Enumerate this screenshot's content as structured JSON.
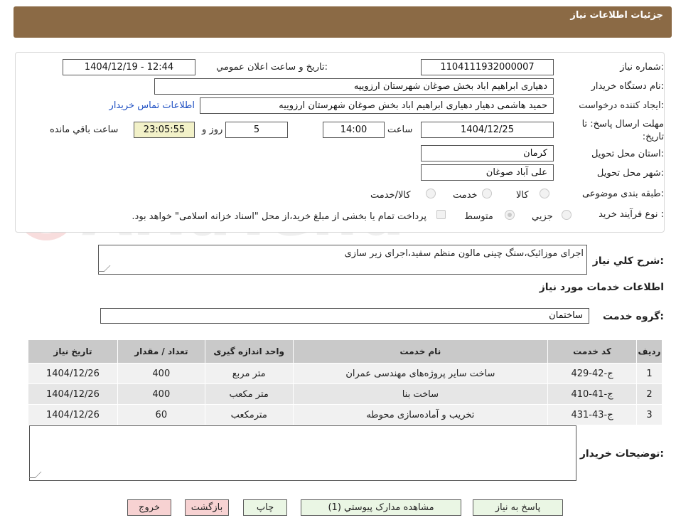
{
  "header": {
    "title": "جزئیات اطلاعات نیاز"
  },
  "form": {
    "need_number_label": "شماره نیاز:",
    "need_number": "1104111932000007",
    "announce_label": "تاریخ و ساعت اعلان عمومي:",
    "announce_value": "1404/12/19 - 12:44",
    "buyer_org_label": "نام دستگاه خريدار:",
    "buyer_org": "دهیاری ابراهیم اباد بخش صوغان شهرستان ارزوییه",
    "creator_label": "ايجاد كننده درخواست:",
    "creator": "حمید هاشمی دهیار دهیاری ابراهیم اباد بخش صوغان شهرستان ارزوییه",
    "contact_link": "اطلاعات تماس خريدار",
    "deadline_label": "مهلت ارسال پاسخ: تا تاریخ:",
    "deadline_date": "1404/12/25",
    "time_label": "ساعت",
    "deadline_time": "14:00",
    "days": "5",
    "days_label": "روز و",
    "remaining_time": "23:05:55",
    "remaining_label": "ساعت باقي مانده",
    "province_label": "استان محل تحويل:",
    "province": "كرمان",
    "city_label": "شهر محل تحويل:",
    "city": "علی آباد صوغان",
    "category_label": "طبقه بندی موضوعی:",
    "category_options": [
      "کالا",
      "خدمت",
      "کالا/خدمت"
    ],
    "process_label": "نوع فرآيند خريد :",
    "process_options": [
      "جزيي",
      "متوسط"
    ],
    "payment_note": "پرداخت تمام يا بخشی از مبلغ خريد،از محل \"اسناد خزانه اسلامی\" خواهد بود."
  },
  "summary": {
    "label": "شرح کلي نياز:",
    "text": "اجرای موزائیک،سنگ چینی مالون منظم سفید،اجرای زیر سازی"
  },
  "services": {
    "section_title": "اطلاعات خدمات مورد نياز",
    "group_label": "گروه خدمت:",
    "group_value": "ساختمان",
    "columns": [
      "رديف",
      "کد خدمت",
      "نام خدمت",
      "واحد اندازه گيری",
      "تعداد / مقدار",
      "تاریخ نیاز"
    ],
    "rows": [
      {
        "idx": "1",
        "code": "ج-42-429",
        "name": "ساخت سایر پروژه‌های مهندسی عمران",
        "unit": "متر مربع",
        "qty": "400",
        "date": "1404/12/26"
      },
      {
        "idx": "2",
        "code": "ج-41-410",
        "name": "ساخت بنا",
        "unit": "متر مکعب",
        "qty": "400",
        "date": "1404/12/26"
      },
      {
        "idx": "3",
        "code": "ج-43-431",
        "name": "تخریب و آماده‌سازی محوطه",
        "unit": "مترمکعب",
        "qty": "60",
        "date": "1404/12/26"
      }
    ]
  },
  "buyer_notes": {
    "label": "توضيحات خريدار:",
    "value": ""
  },
  "buttons": {
    "reply": "پاسخ به نياز",
    "attachments": "مشاهده مدارک پيوستي (1)",
    "print": "چاپ",
    "back": "بازگشت",
    "exit": "خروج"
  },
  "watermark": "AriaTender.neT",
  "colors": {
    "header_bg": "#8b6a45",
    "link": "#1e4fc3",
    "remaining_bg": "#f2f1c8",
    "exit_bg": "#f7d2d2",
    "action_bg": "#eaf6e4"
  }
}
